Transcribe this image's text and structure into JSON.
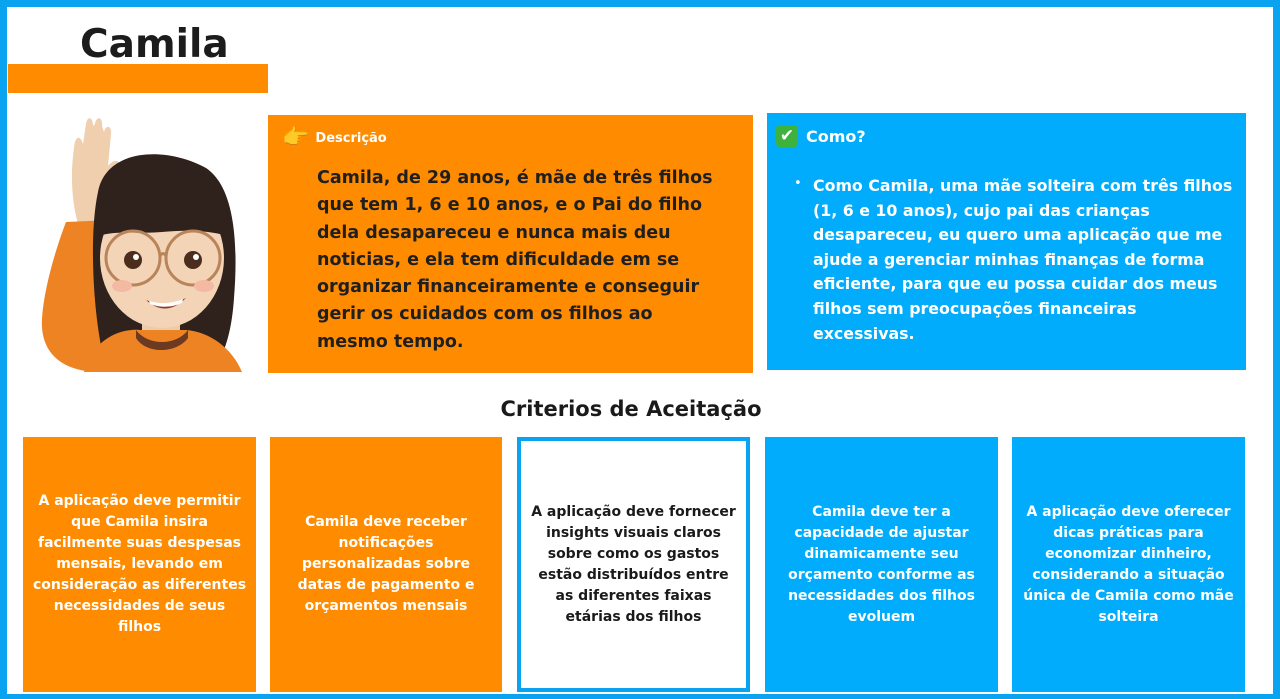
{
  "persona": {
    "name": "Camila"
  },
  "description": {
    "heading": "Descrição",
    "icon": "pointing-hand-icon",
    "text": "Camila, de 29 anos, é mãe de três filhos que tem 1, 6 e 10 anos, e o Pai do filho dela desapareceu e nunca mais deu noticias, e ela tem dificuldade em se organizar financeiramente e conseguir gerir os cuidados com os filhos ao mesmo tempo."
  },
  "como": {
    "heading": "Como?",
    "icon": "check-mark-icon",
    "bullet": "•",
    "text": "Como Camila, uma mãe solteira com três filhos (1, 6 e 10 anos), cujo pai das crianças desapareceu, eu quero uma aplicação que me ajude a gerenciar minhas finanças de forma eficiente, para que eu possa cuidar dos meus filhos sem preocupações financeiras excessivas."
  },
  "criteria": {
    "title": "Criterios de Aceitação",
    "items": [
      "A aplicação deve permitir que Camila insira facilmente suas despesas mensais, levando em consideração as diferentes necessidades de seus filhos",
      "Camila deve receber notificações personalizadas sobre datas de pagamento e orçamentos mensais",
      "A aplicação deve fornecer insights visuais claros sobre como os gastos estão distribuídos entre as diferentes faixas etárias dos filhos",
      "Camila deve ter a capacidade de ajustar dinamicamente seu orçamento conforme as necessidades dos filhos evoluem",
      "A aplicação deve oferecer dicas práticas para economizar dinheiro, considerando a situação única de Camila como mãe solteira"
    ]
  },
  "colors": {
    "orange": "#ff8c00",
    "blue": "#00acfb",
    "frame": "#0aa3f0"
  }
}
